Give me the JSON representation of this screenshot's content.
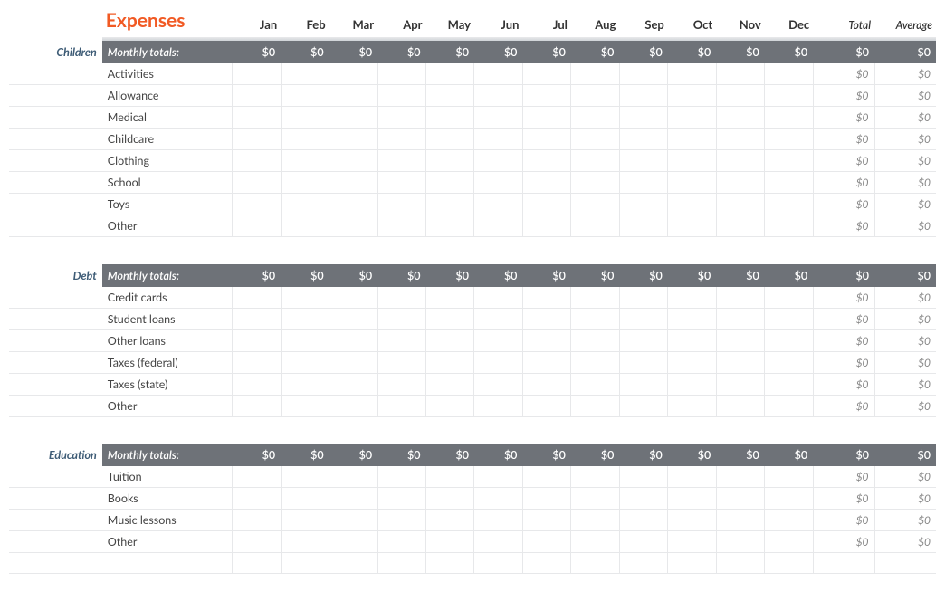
{
  "title": "Expenses",
  "months": [
    "Jan",
    "Feb",
    "Mar",
    "Apr",
    "May",
    "Jun",
    "Jul",
    "Aug",
    "Sep",
    "Oct",
    "Nov",
    "Dec"
  ],
  "summary_headers": {
    "total": "Total",
    "average": "Average"
  },
  "totals_label": "Monthly totals:",
  "zero": "$0",
  "sections": [
    {
      "name": "Children",
      "totals": {
        "months": [
          "$0",
          "$0",
          "$0",
          "$0",
          "$0",
          "$0",
          "$0",
          "$0",
          "$0",
          "$0",
          "$0",
          "$0"
        ],
        "total": "$0",
        "average": "$0"
      },
      "rows": [
        {
          "label": "Activities",
          "total": "$0",
          "average": "$0"
        },
        {
          "label": "Allowance",
          "total": "$0",
          "average": "$0"
        },
        {
          "label": "Medical",
          "total": "$0",
          "average": "$0"
        },
        {
          "label": "Childcare",
          "total": "$0",
          "average": "$0"
        },
        {
          "label": "Clothing",
          "total": "$0",
          "average": "$0"
        },
        {
          "label": "School",
          "total": "$0",
          "average": "$0"
        },
        {
          "label": "Toys",
          "total": "$0",
          "average": "$0"
        },
        {
          "label": "Other",
          "total": "$0",
          "average": "$0"
        }
      ]
    },
    {
      "name": "Debt",
      "totals": {
        "months": [
          "$0",
          "$0",
          "$0",
          "$0",
          "$0",
          "$0",
          "$0",
          "$0",
          "$0",
          "$0",
          "$0",
          "$0"
        ],
        "total": "$0",
        "average": "$0"
      },
      "rows": [
        {
          "label": "Credit cards",
          "total": "$0",
          "average": "$0"
        },
        {
          "label": "Student loans",
          "total": "$0",
          "average": "$0"
        },
        {
          "label": "Other loans",
          "total": "$0",
          "average": "$0"
        },
        {
          "label": "Taxes (federal)",
          "total": "$0",
          "average": "$0"
        },
        {
          "label": "Taxes (state)",
          "total": "$0",
          "average": "$0"
        },
        {
          "label": "Other",
          "total": "$0",
          "average": "$0"
        }
      ]
    },
    {
      "name": "Education",
      "totals": {
        "months": [
          "$0",
          "$0",
          "$0",
          "$0",
          "$0",
          "$0",
          "$0",
          "$0",
          "$0",
          "$0",
          "$0",
          "$0"
        ],
        "total": "$0",
        "average": "$0"
      },
      "rows": [
        {
          "label": "Tuition",
          "total": "$0",
          "average": "$0"
        },
        {
          "label": "Books",
          "total": "$0",
          "average": "$0"
        },
        {
          "label": "Music lessons",
          "total": "$0",
          "average": "$0"
        },
        {
          "label": "Other",
          "total": "$0",
          "average": "$0"
        }
      ],
      "trailing_empty": true
    }
  ]
}
